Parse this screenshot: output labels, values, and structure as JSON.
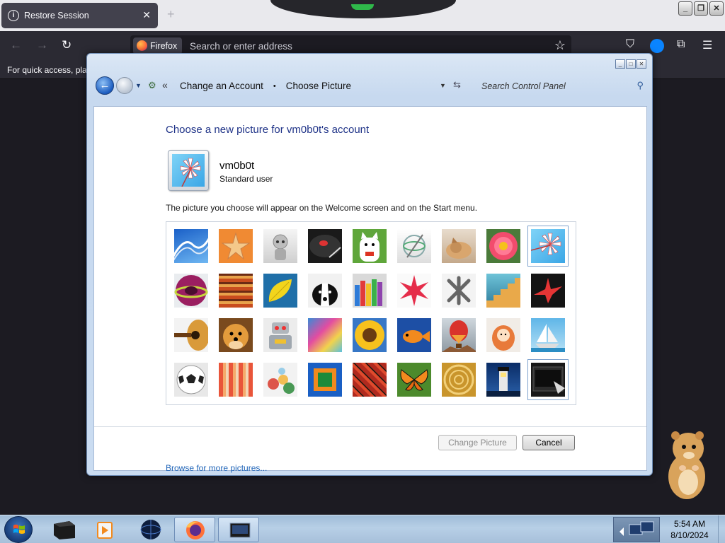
{
  "browser": {
    "tab_title": "Restore Session",
    "tab_info_glyph": "i",
    "tab_close_glyph": "✕",
    "new_tab_glyph": "+",
    "identity_chip": "Firefox",
    "address_placeholder": "Search or enter address",
    "bookmarks_hint": "For quick access, plac"
  },
  "dialog": {
    "breadcrumb": [
      "Change an Account",
      "Choose Picture"
    ],
    "breadcrumb_separator": "•",
    "overflow_glyph": "«",
    "search_placeholder": "Search Control Panel",
    "heading": "Choose a new picture for vm0b0t's account",
    "account": {
      "name": "vm0b0t",
      "type": "Standard user"
    },
    "description": "The picture you choose will appear on the Welcome screen and on the Start menu.",
    "pictures": [
      "roller-coaster",
      "starfish",
      "robot-toy",
      "turntable",
      "lucky-cat",
      "gyroscope",
      "kitten",
      "daisy",
      "pinwheel",
      "ball",
      "fabric",
      "leaf",
      "dog",
      "crayons",
      "paper-star",
      "jacks",
      "stairs",
      "origami-crane",
      "guitar",
      "puppy",
      "tin-robot",
      "silk",
      "sunflower",
      "fish",
      "hot-air-balloon",
      "doll",
      "sailboat",
      "soccer-ball",
      "stripes",
      "marbles",
      "frame",
      "textile",
      "butterfly",
      "woven-chair",
      "lighthouse",
      "custom-dark"
    ],
    "selected_picture": "pinwheel",
    "browse_link": "Browse for more pictures...",
    "change_button": "Change Picture",
    "cancel_button": "Cancel"
  },
  "taskbar": {
    "time": "5:54 AM",
    "date": "8/10/2024"
  }
}
